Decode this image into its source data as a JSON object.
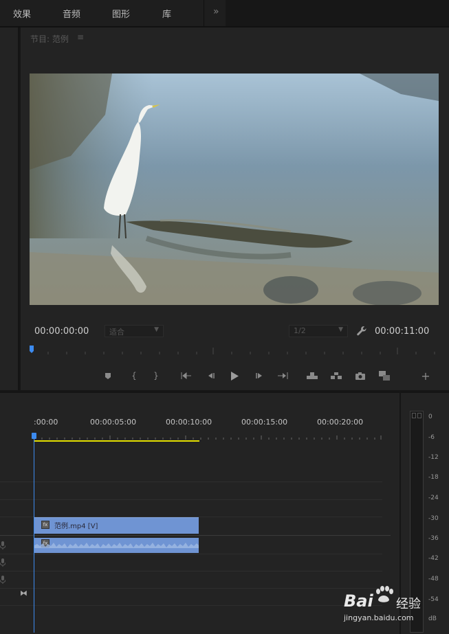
{
  "top_tabs": [
    "效果",
    "音频",
    "图形",
    "库"
  ],
  "more_glyph": "»",
  "program_panel": {
    "title": "节目: 范例",
    "menu_glyph": "≡",
    "timecode_current": "00:00:00:00",
    "timecode_duration": "00:00:11:00",
    "fit_select": "适合",
    "resolution_select": "1/2"
  },
  "transport_icons": [
    "add-marker-icon",
    "mark-in-icon",
    "mark-out-icon",
    "go-to-in-icon",
    "step-back-icon",
    "play-icon",
    "step-forward-icon",
    "go-to-out-icon",
    "lift-icon",
    "extract-icon",
    "export-frame-icon",
    "compare-view-icon",
    "button-editor-add-icon"
  ],
  "timeline": {
    "ruler_labels": [
      ":00:00",
      "00:00:05:00",
      "00:00:10:00",
      "00:00:15:00",
      "00:00:20:00"
    ],
    "video_clip_label": "范例.mp4 [V]",
    "fx_glyph": "fx"
  },
  "audio_meter": {
    "db_labels": [
      "0",
      "-6",
      "-12",
      "-18",
      "-24",
      "-30",
      "-36",
      "-42",
      "-48",
      "-54",
      "dB"
    ]
  },
  "watermark": {
    "brand": "Bai",
    "brand_suffix": "经验",
    "url": "jingyan.baidu.com"
  },
  "colors": {
    "accent_blue": "#3c8bf0",
    "clip_blue": "#6f94d3",
    "workarea_yellow": "#e4e000"
  }
}
